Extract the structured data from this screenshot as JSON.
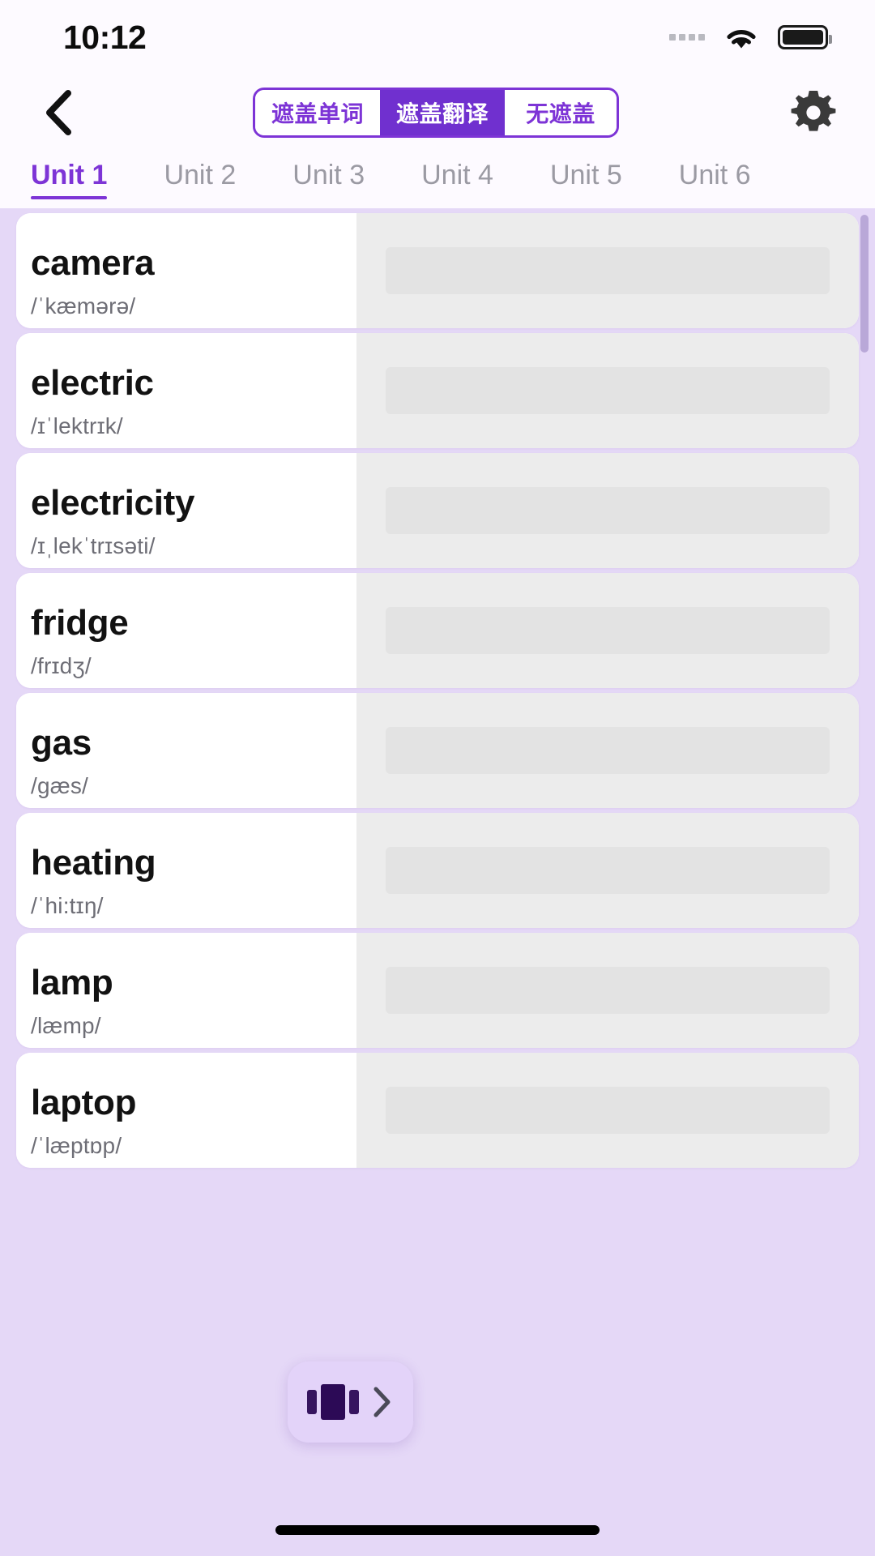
{
  "status_bar": {
    "time": "10:12",
    "signal_icon": "signal-dots-icon",
    "wifi_icon": "wifi-icon",
    "battery_icon": "battery-icon"
  },
  "header": {
    "back_icon": "chevron-left-icon",
    "settings_icon": "gear-icon",
    "mode_segments": [
      {
        "label": "遮盖单词",
        "active": false
      },
      {
        "label": "遮盖翻译",
        "active": true
      },
      {
        "label": "无遮盖",
        "active": false
      }
    ]
  },
  "unit_tabs": {
    "active_index": 0,
    "items": [
      {
        "label": "Unit 1"
      },
      {
        "label": "Unit 2"
      },
      {
        "label": "Unit 3"
      },
      {
        "label": "Unit 4"
      },
      {
        "label": "Unit 5"
      },
      {
        "label": "Unit 6"
      }
    ]
  },
  "word_list": [
    {
      "word": "camera",
      "phonetic": "/ˈkæmərə/",
      "translation_masked": true
    },
    {
      "word": "electric",
      "phonetic": "/ɪˈlektrɪk/",
      "translation_masked": true
    },
    {
      "word": "electricity",
      "phonetic": "/ɪˌlekˈtrɪsəti/",
      "translation_masked": true
    },
    {
      "word": "fridge",
      "phonetic": "/frɪdʒ/",
      "translation_masked": true
    },
    {
      "word": "gas",
      "phonetic": "/gæs/",
      "translation_masked": true
    },
    {
      "word": "heating",
      "phonetic": "/ˈhi:tɪŋ/",
      "translation_masked": true
    },
    {
      "word": "lamp",
      "phonetic": "/læmp/",
      "translation_masked": true
    },
    {
      "word": "laptop",
      "phonetic": "/ˈlæptɒp/",
      "translation_masked": true
    }
  ],
  "fab": {
    "carousel_icon": "card-carousel-icon",
    "next_icon": "chevron-right-icon"
  },
  "colors": {
    "accent": "#7d34d6",
    "accent_fill": "#7030cf",
    "list_background": "#e5d8f7",
    "card_background": "#ffffff",
    "mask_background": "#ececec",
    "fab_background": "#e3d3f9"
  }
}
